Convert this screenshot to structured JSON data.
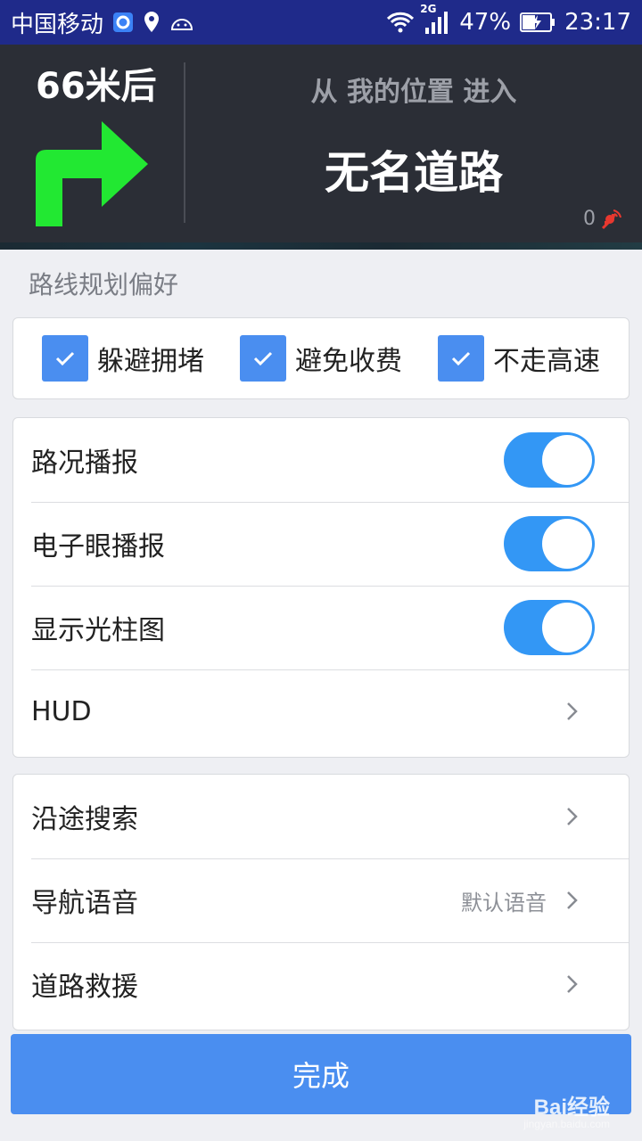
{
  "status_bar": {
    "carrier": "中国移动",
    "network": "2G",
    "battery": "47%",
    "time": "23:17"
  },
  "nav": {
    "distance": "66米后",
    "from_text": "从 我的位置 进入",
    "road_name": "无名道路",
    "gps_count": "0",
    "turn_color": "#22e832"
  },
  "settings": {
    "section_title": "路线规划偏好",
    "preferences": [
      {
        "label": "躲避拥堵",
        "checked": true
      },
      {
        "label": "避免收费",
        "checked": true
      },
      {
        "label": "不走高速",
        "checked": true
      }
    ],
    "toggles": [
      {
        "label": "路况播报",
        "on": true
      },
      {
        "label": "电子眼播报",
        "on": true
      },
      {
        "label": "显示光柱图",
        "on": true
      }
    ],
    "hud_label": "HUD",
    "links": [
      {
        "label": "沿途搜索",
        "value": ""
      },
      {
        "label": "导航语音",
        "value": "默认语音"
      },
      {
        "label": "道路救援",
        "value": ""
      }
    ],
    "done_label": "完成",
    "accent": "#4a8ef0",
    "toggle_color": "#3397f5"
  },
  "watermark": {
    "brand": "Bai经验",
    "url": "jingyan.baidu.com"
  }
}
